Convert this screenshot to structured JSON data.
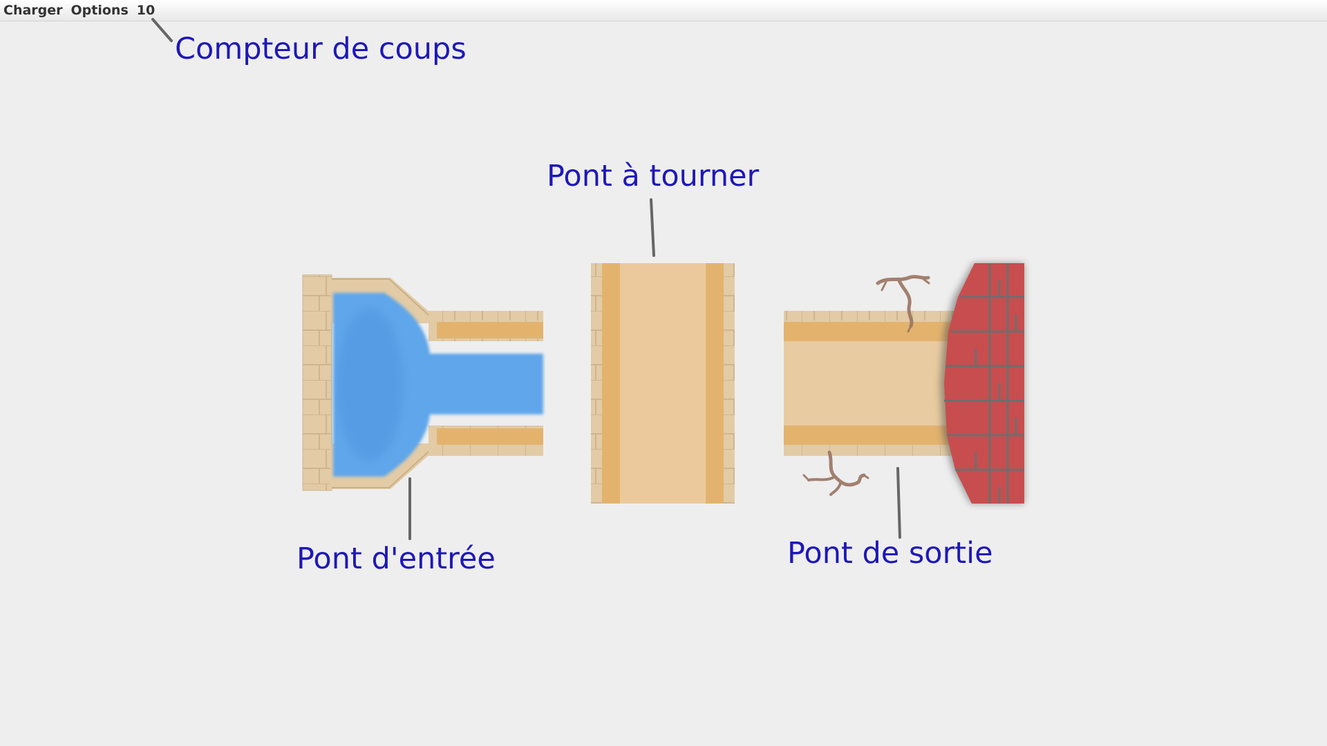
{
  "menubar": {
    "load_label": "Charger",
    "options_label": "Options",
    "move_count": "10"
  },
  "annotations": {
    "counter": "Compteur de coups",
    "rotate_bridge": "Pont à tourner",
    "entry_bridge": "Pont d'entrée",
    "exit_bridge": "Pont de sortie"
  },
  "colors": {
    "annotation_text": "#1e18b8",
    "pointer_line": "#666666",
    "water": "#5ea6ea",
    "stone": "#e2cba5",
    "bridge_deck": "#ecc99c",
    "bridge_rail": "#e3b36e",
    "brick_wall": "#c84d4e",
    "mortar": "#6e6e6e",
    "crack": "#9a7462",
    "background": "#eeeeee"
  }
}
